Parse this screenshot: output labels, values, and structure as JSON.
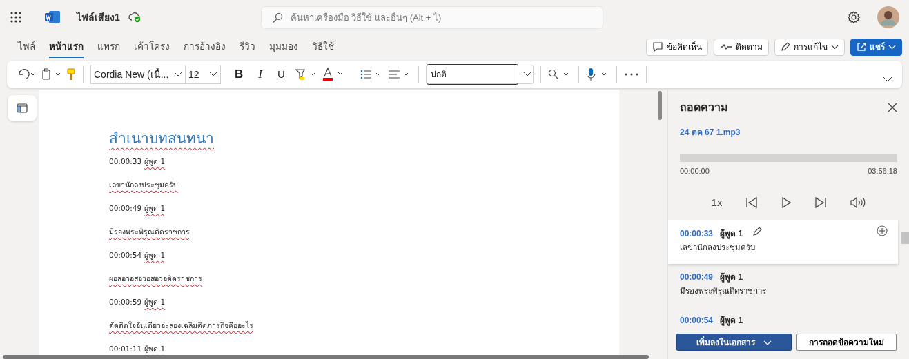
{
  "app": {
    "title": "ไฟล์เสียง1",
    "search": {
      "placeholder": "ค้นหาเครื่องมือ วิธีใช้ และอื่นๆ (Alt + ไ)"
    }
  },
  "ribbon_tabs": [
    {
      "label": "ไฟล์",
      "selected": false
    },
    {
      "label": "หน้าแรก",
      "selected": true
    },
    {
      "label": "แทรก",
      "selected": false
    },
    {
      "label": "เค้าโครง",
      "selected": false
    },
    {
      "label": "การอ้างอิง",
      "selected": false
    },
    {
      "label": "รีวิว",
      "selected": false
    },
    {
      "label": "มุมมอง",
      "selected": false
    },
    {
      "label": "วิธีใช้",
      "selected": false
    }
  ],
  "actions": [
    {
      "label": "ข้อคิดเห็น",
      "kind": "comment"
    },
    {
      "label": "ติดตาม",
      "kind": "track"
    },
    {
      "label": "การแก้ไข",
      "kind": "edit"
    },
    {
      "label": "แชร์",
      "kind": "share"
    }
  ],
  "toolbar": {
    "font": "Cordia New (เนื้...",
    "size": "12",
    "format_buttons": [
      "B",
      "I",
      "U"
    ],
    "style": "ปกติ"
  },
  "document": {
    "title": "สำเนาบทสนทนา",
    "lines": [
      {
        "kind": "meta",
        "time": "00:00:33",
        "speaker": "ผู้พูด 1"
      },
      {
        "kind": "text",
        "text": "เลขานักลงประชุมครับ"
      },
      {
        "kind": "meta",
        "time": "00:00:49",
        "speaker": "ผู้พูด 1"
      },
      {
        "kind": "text",
        "text": "มีรองพระพิรุณติดราชการ"
      },
      {
        "kind": "meta",
        "time": "00:00:54",
        "speaker": "ผู้พูด 1"
      },
      {
        "kind": "text",
        "text": "ผอสอวอสอวอสอวอติดราชการ"
      },
      {
        "kind": "meta",
        "time": "00:00:59",
        "speaker": "ผู้พูด 1"
      },
      {
        "kind": "text",
        "text": "ตัดติดใจอันเดียวอ่ะลองเฉลิมติดภารกิจคืออะไร"
      },
      {
        "kind": "meta",
        "time": "00:01:11",
        "speaker": "ผู้พด 1"
      }
    ]
  },
  "transcript": {
    "title": "ถอดความ",
    "file": "24 ตค 67 1.mp3",
    "level": 0,
    "elapsed": "00:00:00",
    "total": "03:56:18",
    "speed": "1x",
    "entries": [
      {
        "time": "00:00:33",
        "speaker": "ผู้พูด 1",
        "text": "เลขานักลงประชุมครับ",
        "selected": true
      },
      {
        "time": "00:00:49",
        "speaker": "ผู้พูด 1",
        "text": "มีรองพระพิรุณติดราชการ",
        "selected": false
      },
      {
        "time": "00:00:54",
        "speaker": "ผู้พูด 1",
        "selected": false
      }
    ],
    "add_button": "เพิ่มลงในเอกสาร",
    "new_button": "การถอดข้อความใหม่"
  }
}
